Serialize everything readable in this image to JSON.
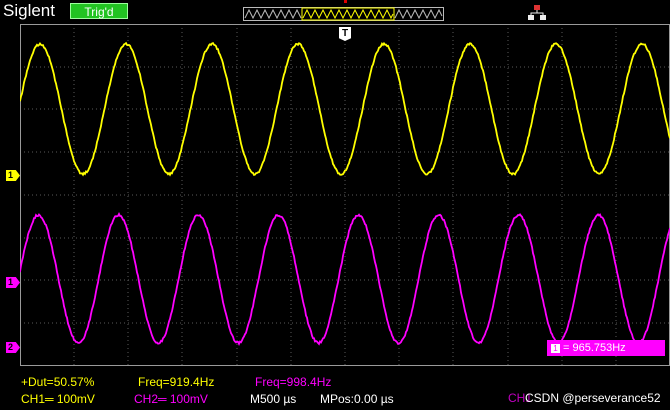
{
  "header": {
    "brand": "Siglent",
    "trigger_status": "Trig'd"
  },
  "markers": {
    "ch1": "1",
    "ch2": "1",
    "ch2_bottom": "2",
    "trigger": "T"
  },
  "measurement_box": {
    "channel": "1",
    "text": "= 965.753Hz"
  },
  "measurements": {
    "duty": "+Dut=50.57%",
    "freq_ch1": "Freq=919.4Hz",
    "freq_ch2": "Freq=998.4Hz"
  },
  "status_bar": {
    "ch1": "CH1═ 100mV",
    "ch2": "CH2═ 100mV",
    "timebase": "M500 µs",
    "mpos": "MPos:0.00 µs",
    "ch_trig": "CH1"
  },
  "watermark": "CSDN @perseverance52",
  "colors": {
    "ch1": "#ffff00",
    "ch2": "#ff00ff",
    "grid": "#5a5a5a",
    "trigger_badge": "#22c322"
  },
  "icons": [
    "network-icon",
    "trigger-marker-icon"
  ]
}
